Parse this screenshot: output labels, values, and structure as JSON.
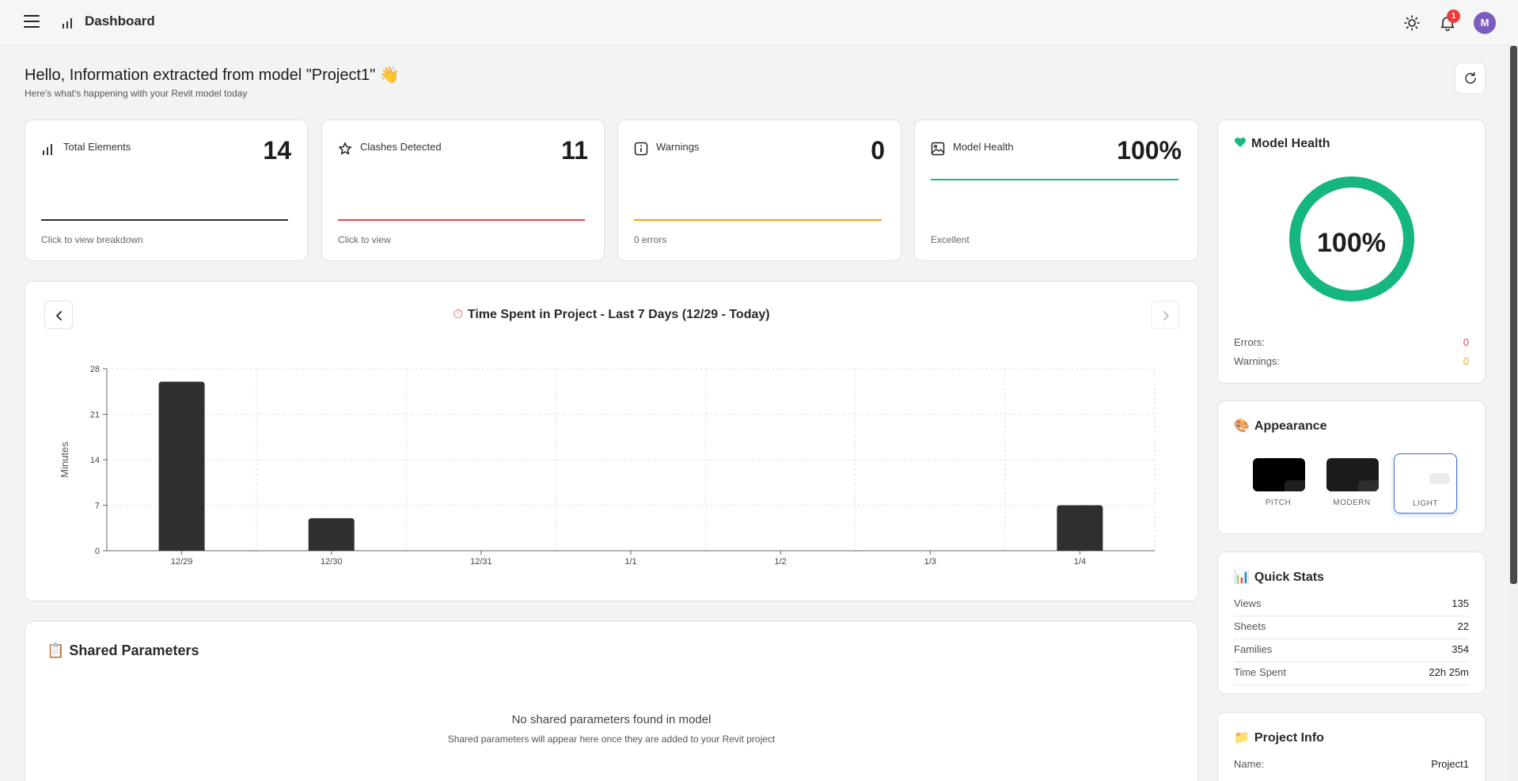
{
  "header": {
    "title": "Dashboard",
    "notification_count": "1",
    "avatar_initial": "M"
  },
  "greeting": {
    "title": "Hello, Information extracted from model \"Project1\" 👋",
    "subtitle": "Here's what's happening with your Revit model today"
  },
  "stats": [
    {
      "label": "Total Elements",
      "value": "14",
      "footer": "Click to view breakdown",
      "line_color": "#2b2b2b"
    },
    {
      "label": "Clashes Detected",
      "value": "11",
      "footer": "Click to view",
      "line_color": "#e5484d"
    },
    {
      "label": "Warnings",
      "value": "0",
      "footer": "0 errors",
      "line_color": "#f2a516"
    },
    {
      "label": "Model Health",
      "value": "100%",
      "footer": "Excellent",
      "line_color": "#18b883"
    }
  ],
  "time_chart": {
    "title": "Time Spent in Project - Last 7 Days (12/29 - Today)",
    "title_icon": "⏱"
  },
  "chart_data": {
    "type": "bar",
    "categories": [
      "12/29",
      "12/30",
      "12/31",
      "1/1",
      "1/2",
      "1/3",
      "1/4"
    ],
    "values": [
      26,
      5,
      0,
      0,
      0,
      0,
      7
    ],
    "ylabel": "Minutes",
    "xlabel": "",
    "ylim": [
      0,
      28
    ],
    "yticks": [
      0,
      7,
      14,
      21,
      28
    ],
    "grid": true,
    "bar_color": "#2f2f2f"
  },
  "shared_parameters": {
    "title": "Shared Parameters",
    "icon": "📋",
    "empty_title": "No shared parameters found in model",
    "empty_sub": "Shared parameters will appear here once they are added to your Revit project"
  },
  "model_health": {
    "title": "Model Health",
    "percent_label": "100%",
    "percent": 100,
    "ring_color": "#16b67f",
    "errors_label": "Errors:",
    "errors_value": "0",
    "warnings_label": "Warnings:",
    "warnings_value": "0"
  },
  "appearance": {
    "title": "Appearance",
    "icon": "🎨",
    "options": [
      {
        "name": "PITCH",
        "bg": "#000000",
        "accent": "#1f1f1f",
        "selected": false
      },
      {
        "name": "MODERN",
        "bg": "#1b1b1b",
        "accent": "#2e2e2e",
        "selected": false
      },
      {
        "name": "LIGHT",
        "bg": "#ffffff",
        "accent": "#ececec",
        "selected": true
      }
    ]
  },
  "quick_stats": {
    "title": "Quick Stats",
    "icon": "📊",
    "rows": [
      {
        "label": "Views",
        "value": "135"
      },
      {
        "label": "Sheets",
        "value": "22"
      },
      {
        "label": "Families",
        "value": "354"
      },
      {
        "label": "Time Spent",
        "value": "22h 25m"
      }
    ]
  },
  "project_info": {
    "title": "Project Info",
    "icon": "📁",
    "name_label": "Name:",
    "name_value": "Project1"
  }
}
